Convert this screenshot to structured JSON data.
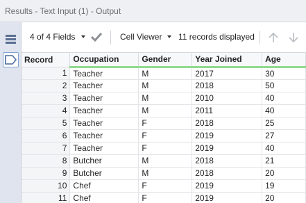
{
  "window": {
    "title": "Results - Text Input (1) - Output"
  },
  "toolbar": {
    "fields_label": "4 of 4 Fields",
    "viewer_label": "Cell Viewer",
    "records_status": "11 records displayed"
  },
  "icons": {
    "sidebar_top": "list-icon",
    "sidebar_active": "tag-icon",
    "apply": "checkmark-icon",
    "prev": "arrow-up-icon",
    "next": "arrow-down-icon"
  },
  "colors": {
    "header_underline": "#8fdc8f",
    "active_border": "#7fa4d3"
  },
  "table": {
    "headers": [
      "Record",
      "Occupation",
      "Gender",
      "Year Joined",
      "Age"
    ],
    "rows": [
      [
        "1",
        "Teacher",
        "M",
        "2017",
        "30"
      ],
      [
        "2",
        "Teacher",
        "M",
        "2018",
        "50"
      ],
      [
        "3",
        "Teacher",
        "M",
        "2010",
        "40"
      ],
      [
        "4",
        "Teacher",
        "M",
        "2011",
        "40"
      ],
      [
        "5",
        "Teacher",
        "F",
        "2018",
        "25"
      ],
      [
        "6",
        "Teacher",
        "F",
        "2019",
        "27"
      ],
      [
        "7",
        "Teacher",
        "F",
        "2019",
        "40"
      ],
      [
        "8",
        "Butcher",
        "M",
        "2018",
        "21"
      ],
      [
        "9",
        "Butcher",
        "M",
        "2018",
        "20"
      ],
      [
        "10",
        "Chef",
        "F",
        "2019",
        "19"
      ],
      [
        "11",
        "Chef",
        "F",
        "2019",
        "20"
      ]
    ]
  }
}
